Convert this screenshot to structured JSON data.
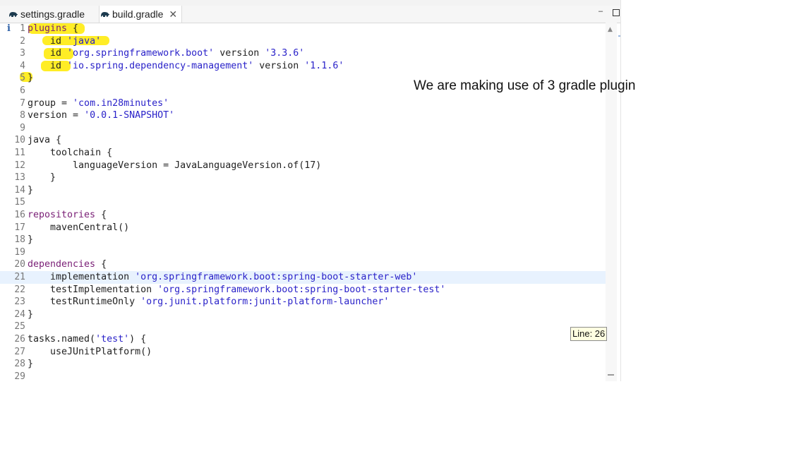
{
  "tabs": [
    {
      "label": "settings.gradle",
      "icon": "gradle-elephant-icon"
    },
    {
      "label": "build.gradle",
      "icon": "gradle-elephant-icon",
      "active": true,
      "dirty": true
    }
  ],
  "tab_close_glyph": "✕",
  "window_controls": {
    "minimize_glyph": "‒",
    "maximize_glyph": ""
  },
  "info_glyph": "i",
  "editor": {
    "current_line": 21,
    "lines": [
      {
        "n": "1",
        "text": "plugins {"
      },
      {
        "n": "2",
        "text": "    id 'java'"
      },
      {
        "n": "3",
        "text": "    id 'org.springframework.boot' version '3.3.6'"
      },
      {
        "n": "4",
        "text": "    id 'io.spring.dependency-management' version '1.1.6'"
      },
      {
        "n": "5",
        "text": "}"
      },
      {
        "n": "6",
        "text": ""
      },
      {
        "n": "7",
        "text": "group = 'com.in28minutes'"
      },
      {
        "n": "8",
        "text": "version = '0.0.1-SNAPSHOT'"
      },
      {
        "n": "9",
        "text": ""
      },
      {
        "n": "10",
        "text": "java {"
      },
      {
        "n": "11",
        "text": "    toolchain {"
      },
      {
        "n": "12",
        "text": "        languageVersion = JavaLanguageVersion.of(17)"
      },
      {
        "n": "13",
        "text": "    }"
      },
      {
        "n": "14",
        "text": "}"
      },
      {
        "n": "15",
        "text": ""
      },
      {
        "n": "16",
        "text": "repositories {"
      },
      {
        "n": "17",
        "text": "    mavenCentral()"
      },
      {
        "n": "18",
        "text": "}"
      },
      {
        "n": "19",
        "text": ""
      },
      {
        "n": "20",
        "text": "dependencies {"
      },
      {
        "n": "21",
        "text": "    implementation 'org.springframework.boot:spring-boot-starter-web'"
      },
      {
        "n": "22",
        "text": "    testImplementation 'org.springframework.boot:spring-boot-starter-test'"
      },
      {
        "n": "23",
        "text": "    testRuntimeOnly 'org.junit.platform:junit-platform-launcher'"
      },
      {
        "n": "24",
        "text": "}"
      },
      {
        "n": "25",
        "text": ""
      },
      {
        "n": "26",
        "text": "tasks.named('test') {"
      },
      {
        "n": "27",
        "text": "    useJUnitPlatform()"
      },
      {
        "n": "28",
        "text": "}"
      },
      {
        "n": "29",
        "text": ""
      }
    ]
  },
  "tooltip": "Line: 26",
  "annotation": "We are making use of 3 gradle plugin",
  "colors": {
    "keyword": "#7a1f76",
    "string": "#2a22c9",
    "highlighter": "#ffea00",
    "current_line": "#e8f2fe"
  }
}
